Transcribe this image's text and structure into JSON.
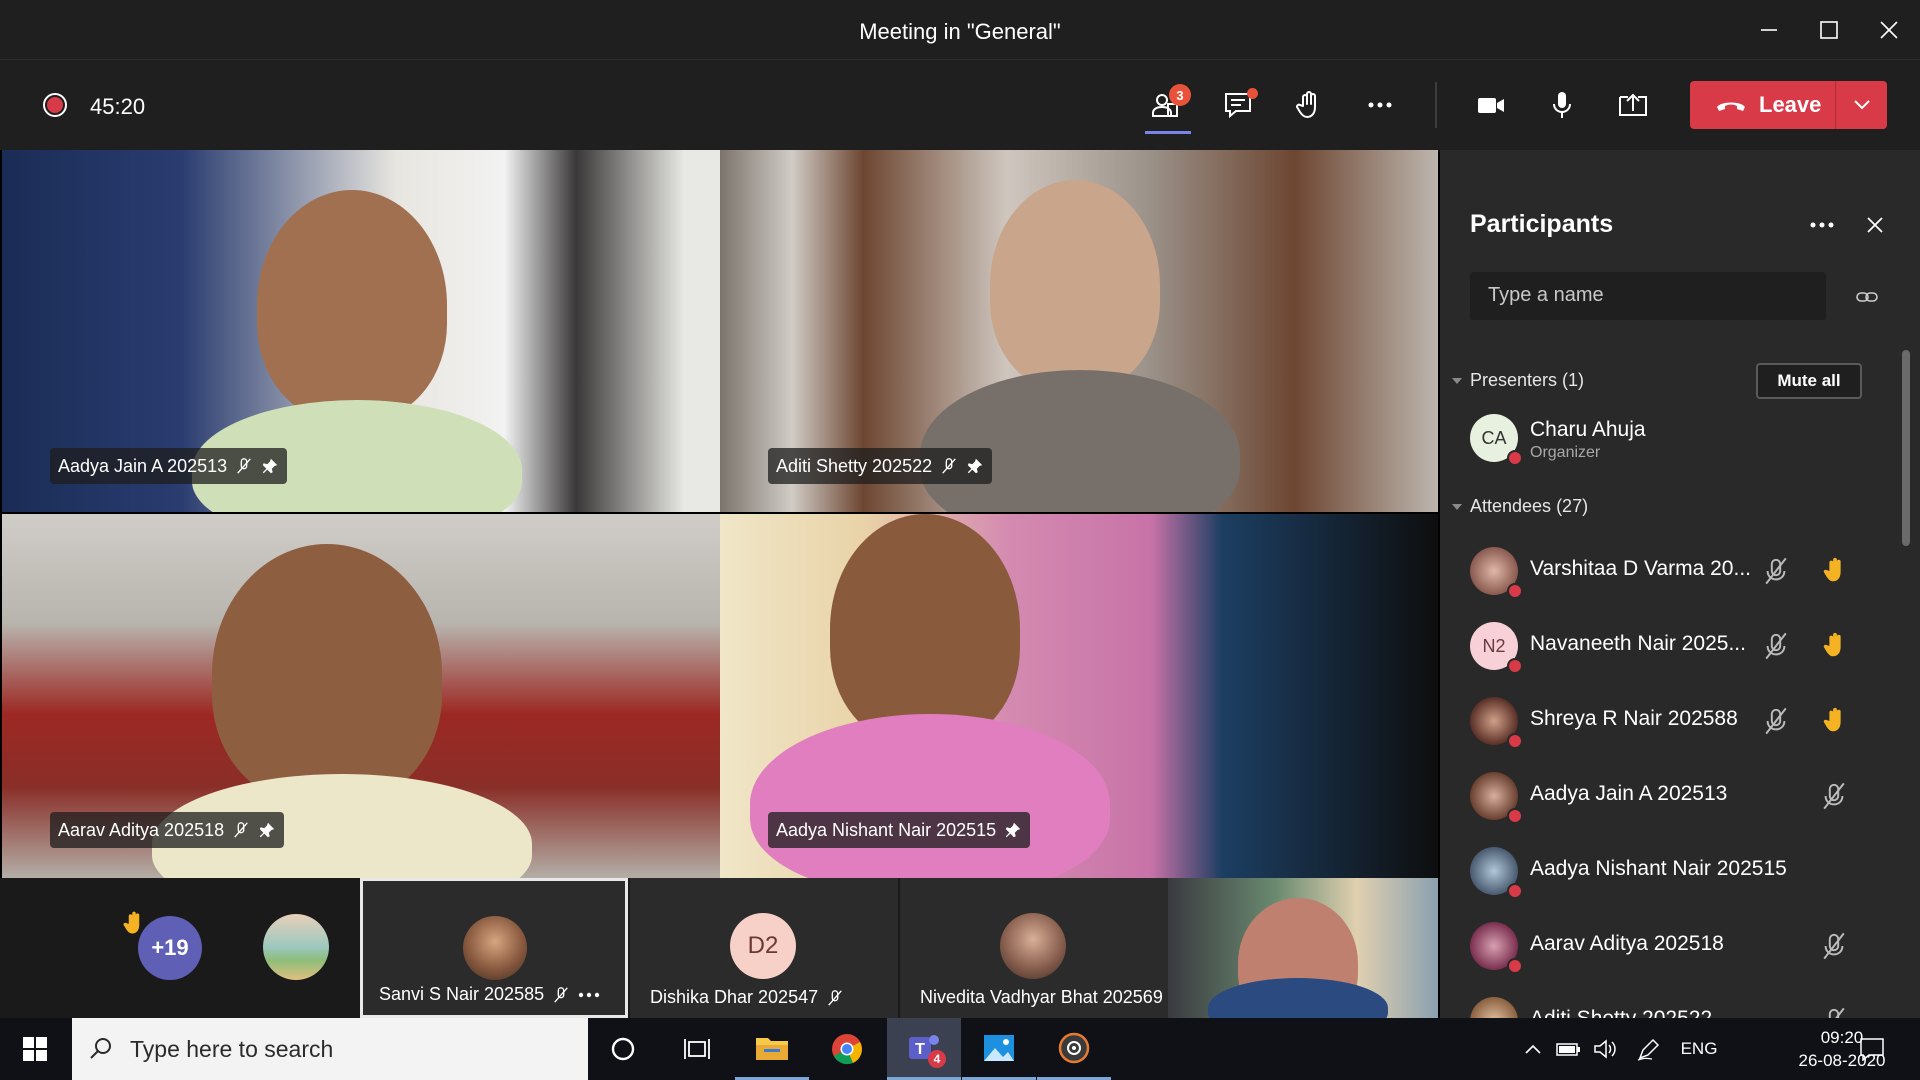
{
  "window": {
    "title": "Meeting in \"General\""
  },
  "toolbar": {
    "timer": "45:20",
    "participants_badge": "3",
    "leave_label": "Leave"
  },
  "videos": [
    {
      "name": "Aadya Jain A 202513"
    },
    {
      "name": "Aditi Shetty 202522"
    },
    {
      "name": "Aarav Aditya 202518"
    },
    {
      "name": "Aadya Nishant Nair 202515"
    }
  ],
  "strip": {
    "more_count": "+19",
    "tiles": [
      {
        "name": "Sanvi S Nair 202585"
      },
      {
        "name": "Dishika Dhar 202547",
        "initials": "D2"
      },
      {
        "name": "Nivedita Vadhyar Bhat 202569"
      }
    ]
  },
  "panel": {
    "title": "Participants",
    "search_placeholder": "Type a name",
    "presenters_label": "Presenters (1)",
    "mute_all": "Mute all",
    "attendees_label": "Attendees (27)",
    "presenter": {
      "initials": "CA",
      "name": "Charu Ahuja",
      "role": "Organizer"
    },
    "attendees": [
      {
        "name": "Varshitaa D Varma 20...",
        "muted": true,
        "hand": true
      },
      {
        "name": "Navaneeth Nair 2025...",
        "initials": "N2",
        "muted": true,
        "hand": true
      },
      {
        "name": "Shreya R Nair 202588",
        "muted": true,
        "hand": true
      },
      {
        "name": "Aadya Jain A 202513",
        "muted": true,
        "hand": false
      },
      {
        "name": "Aadya Nishant Nair 202515",
        "muted": false,
        "hand": false
      },
      {
        "name": "Aarav Aditya 202518",
        "muted": true,
        "hand": false
      },
      {
        "name": "Aditi Shetty 202522",
        "muted": true,
        "hand": false
      }
    ]
  },
  "taskbar": {
    "search_placeholder": "Type here to search",
    "teams_badge": "4",
    "lang": "ENG",
    "time": "09:20",
    "date": "26-08-2020"
  },
  "colors": {
    "accent_red": "#d83a48",
    "badge_orange": "#e8523a",
    "raised_hand": "#f5b324"
  }
}
